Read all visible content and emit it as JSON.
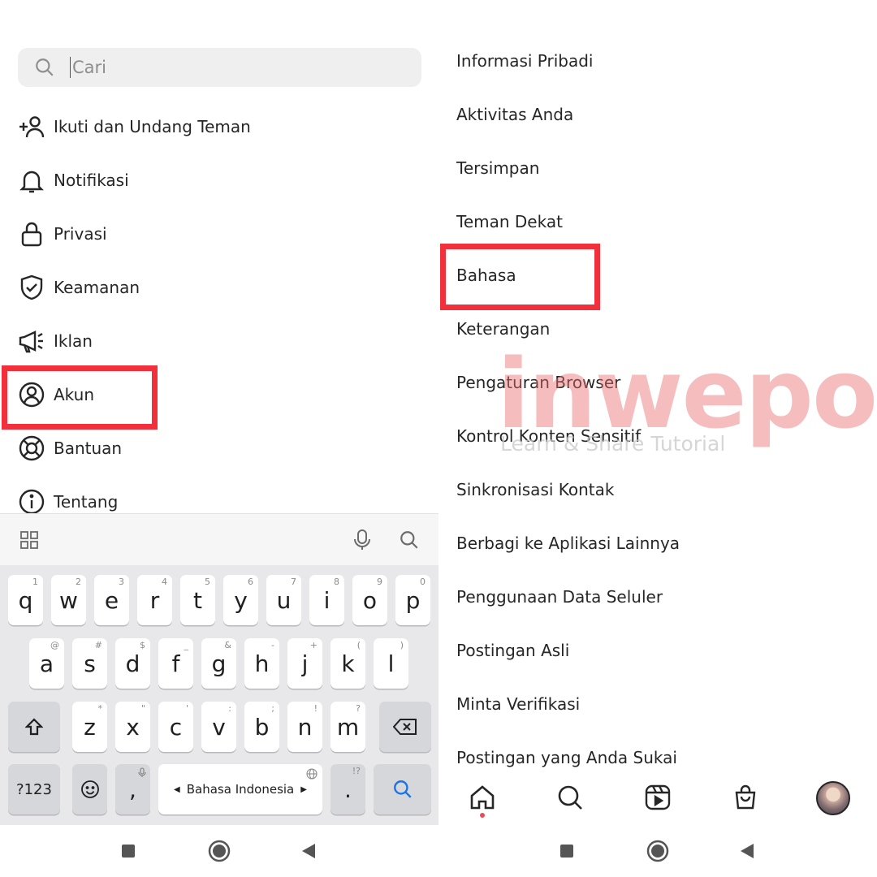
{
  "left": {
    "search": {
      "placeholder": "Cari"
    },
    "menu": [
      {
        "label": "Ikuti dan Undang Teman",
        "icon": "add-person-icon"
      },
      {
        "label": "Notifikasi",
        "icon": "bell-icon"
      },
      {
        "label": "Privasi",
        "icon": "lock-icon"
      },
      {
        "label": "Keamanan",
        "icon": "shield-check-icon"
      },
      {
        "label": "Iklan",
        "icon": "megaphone-icon"
      },
      {
        "label": "Akun",
        "icon": "account-circle-icon"
      },
      {
        "label": "Bantuan",
        "icon": "lifebuoy-icon"
      },
      {
        "label": "Tentang",
        "icon": "info-icon"
      }
    ],
    "highlighted_item": "Akun"
  },
  "keyboard": {
    "row1": [
      {
        "k": "q",
        "h": "1"
      },
      {
        "k": "w",
        "h": "2"
      },
      {
        "k": "e",
        "h": "3"
      },
      {
        "k": "r",
        "h": "4"
      },
      {
        "k": "t",
        "h": "5"
      },
      {
        "k": "y",
        "h": "6"
      },
      {
        "k": "u",
        "h": "7"
      },
      {
        "k": "i",
        "h": "8"
      },
      {
        "k": "o",
        "h": "9"
      },
      {
        "k": "p",
        "h": "0"
      }
    ],
    "row2": [
      {
        "k": "a",
        "h": "@"
      },
      {
        "k": "s",
        "h": "#"
      },
      {
        "k": "d",
        "h": "$"
      },
      {
        "k": "f",
        "h": "_"
      },
      {
        "k": "g",
        "h": "&"
      },
      {
        "k": "h",
        "h": "-"
      },
      {
        "k": "j",
        "h": "+"
      },
      {
        "k": "k",
        "h": "("
      },
      {
        "k": "l",
        "h": ")"
      }
    ],
    "row3": [
      {
        "k": "z",
        "h": "*"
      },
      {
        "k": "x",
        "h": "\""
      },
      {
        "k": "c",
        "h": "'"
      },
      {
        "k": "v",
        "h": ":"
      },
      {
        "k": "b",
        "h": ";"
      },
      {
        "k": "n",
        "h": "!"
      },
      {
        "k": "m",
        "h": "?"
      }
    ],
    "symbols_label": "?123",
    "comma": ",",
    "space_label": "Bahasa Indonesia",
    "period": ".",
    "period_hint": "!?"
  },
  "right": {
    "items": [
      "Informasi Pribadi",
      "Aktivitas Anda",
      "Tersimpan",
      "Teman Dekat",
      "Bahasa",
      "Keterangan",
      "Pengaturan Browser",
      "Kontrol Konten Sensitif",
      "Sinkronisasi Kontak",
      "Berbagi ke Aplikasi Lainnya",
      "Penggunaan Data Seluler",
      "Postingan Asli",
      "Minta Verifikasi",
      "Postingan yang Anda Sukai"
    ],
    "highlighted_item": "Bahasa"
  },
  "watermark": {
    "brand": "inwepo",
    "tagline": "Learn & Share Tutorial"
  },
  "colors": {
    "highlight": "#f2303b",
    "text": "#262626",
    "search_bg": "#efefef",
    "accent_blue": "#1a73e8"
  }
}
